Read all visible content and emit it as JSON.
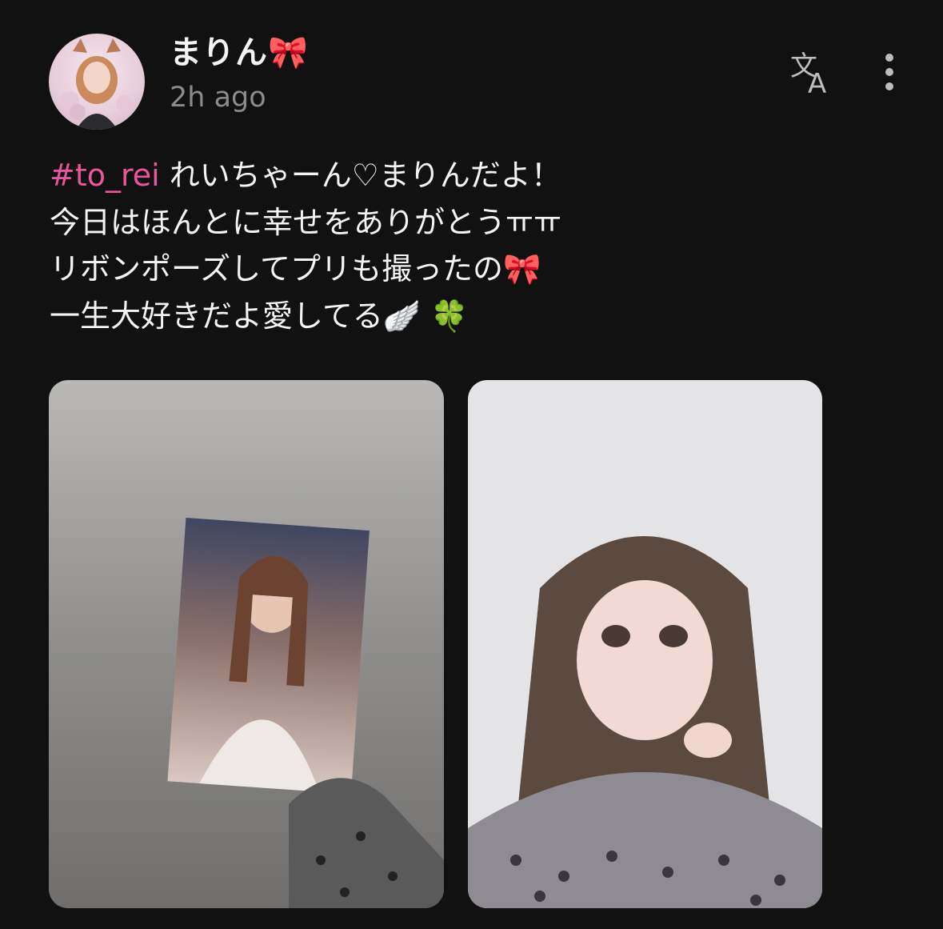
{
  "post": {
    "author": {
      "display_name": "まりん🎀",
      "avatar_icon": "avatar-image"
    },
    "timestamp": "2h ago",
    "actions": {
      "translate_icon": "translate-icon",
      "more_icon": "more-vertical-icon"
    },
    "content": {
      "hashtag": "#to_rei",
      "lines": [
        " れいちゃーん♡まりんだよ！",
        "今日はほんとに幸せをありがとうㅠㅠ",
        "リボンポーズしてプリも撮ったの🎀",
        "一生大好きだよ愛してる🪽 🍀"
      ]
    },
    "media": [
      {
        "type": "photo",
        "alt": "Hand holding photocard"
      },
      {
        "type": "photo",
        "alt": "Purikura photo with ribbon pose"
      }
    ],
    "colors": {
      "background": "#111112",
      "hashtag": "#e9569d",
      "timestamp": "#8b8b8f",
      "icon": "#bdbdc1"
    }
  }
}
